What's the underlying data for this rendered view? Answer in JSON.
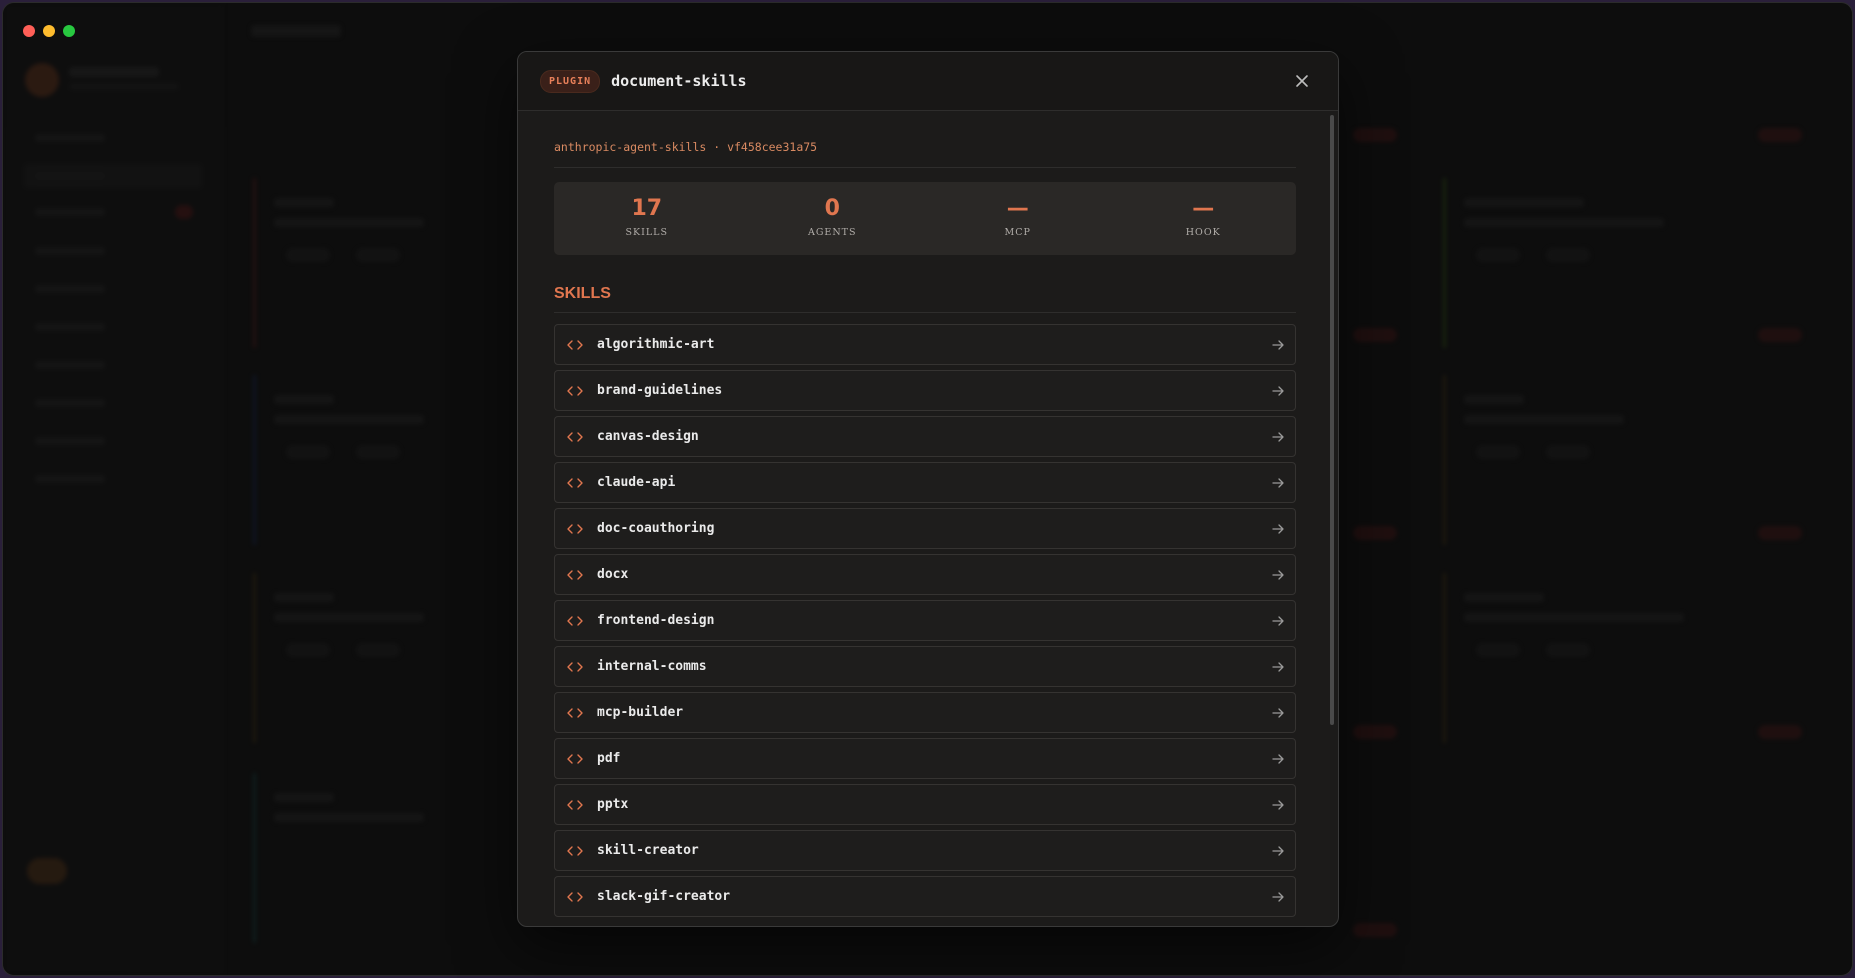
{
  "modal": {
    "badge": "PLUGIN",
    "title": "document-skills",
    "source": "anthropic-agent-skills · vf458cee31a75",
    "stats": [
      {
        "value": "17",
        "label": "SKILLS"
      },
      {
        "value": "0",
        "label": "AGENTS"
      },
      {
        "value": "—",
        "label": "MCP"
      },
      {
        "value": "—",
        "label": "HOOK"
      }
    ],
    "section_title": "SKILLS",
    "skills": [
      {
        "name": "algorithmic-art"
      },
      {
        "name": "brand-guidelines"
      },
      {
        "name": "canvas-design"
      },
      {
        "name": "claude-api"
      },
      {
        "name": "doc-coauthoring"
      },
      {
        "name": "docx"
      },
      {
        "name": "frontend-design"
      },
      {
        "name": "internal-comms"
      },
      {
        "name": "mcp-builder"
      },
      {
        "name": "pdf"
      },
      {
        "name": "pptx"
      },
      {
        "name": "skill-creator"
      },
      {
        "name": "slack-gif-creator"
      }
    ],
    "icons": {
      "close": "close-icon",
      "skill": "code-brackets-icon",
      "row_arrow": "arrow-right-icon"
    }
  },
  "colors": {
    "accent": "#e0764f",
    "badge_bg": "#3a2019",
    "modal_bg": "#1c1b1a"
  }
}
